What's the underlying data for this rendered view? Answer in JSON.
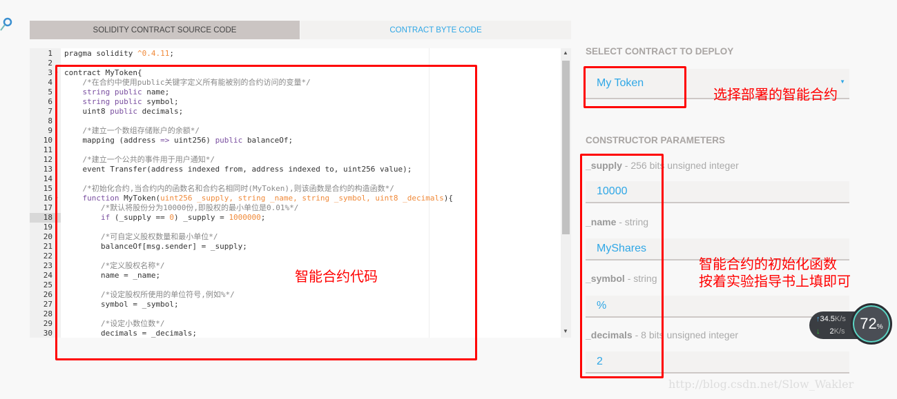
{
  "tabs": [
    {
      "label": "SOLIDITY CONTRACT SOURCE CODE",
      "active": true
    },
    {
      "label": "CONTRACT BYTE CODE",
      "active": false
    }
  ],
  "editor": {
    "active_line": 18,
    "lines": [
      [
        [
          "",
          "pragma solidity "
        ],
        [
          "n",
          "^0.4.11"
        ],
        [
          "",
          ";"
        ]
      ],
      [],
      [
        [
          "",
          "contract MyToken{"
        ]
      ],
      [
        [
          "c",
          "    /*在合约中使用public关键字定义所有能被别的合约访问的变量*/"
        ]
      ],
      [
        [
          "t",
          "    string "
        ],
        [
          "k",
          "public"
        ],
        [
          "",
          " name;"
        ]
      ],
      [
        [
          "t",
          "    string "
        ],
        [
          "k",
          "public"
        ],
        [
          "",
          " symbol;"
        ]
      ],
      [
        [
          "",
          "    uint8 "
        ],
        [
          "k",
          "public"
        ],
        [
          "",
          " decimals;"
        ]
      ],
      [],
      [
        [
          "c",
          "    /*建立一个数组存储账户的余额*/"
        ]
      ],
      [
        [
          "",
          "    mapping (address "
        ],
        [
          "k",
          "=>"
        ],
        [
          "",
          " uint256) "
        ],
        [
          "k",
          "public"
        ],
        [
          "",
          " balanceOf;"
        ]
      ],
      [],
      [
        [
          "c",
          "    /*建立一个公共的事件用于用户通知*/"
        ]
      ],
      [
        [
          "",
          "    event Transfer(address indexed from, address indexed to, uint256 value);"
        ]
      ],
      [],
      [
        [
          "c",
          "    /*初始化合约,当合约内的函数名和合约名相同时(MyToken),则该函数是合约的构造函数*/"
        ]
      ],
      [
        [
          "k",
          "    function"
        ],
        [
          "",
          " MyToken("
        ],
        [
          "n",
          "uint256 _supply, string _name, string _symbol, uint8 _decimals"
        ],
        [
          "",
          "){"
        ]
      ],
      [
        [
          "c",
          "        /*默认将股份分为10000份,即股权的最小单位是0.01%*/"
        ]
      ],
      [
        [
          "k",
          "        if"
        ],
        [
          "",
          " (_supply == "
        ],
        [
          "n",
          "0"
        ],
        [
          "",
          ") _supply = "
        ],
        [
          "n",
          "1000000"
        ],
        [
          "",
          ";"
        ]
      ],
      [],
      [
        [
          "c",
          "        /*可自定义股权数量和最小单位*/"
        ]
      ],
      [
        [
          "",
          "        balanceOf[msg.sender] = _supply;"
        ]
      ],
      [],
      [
        [
          "c",
          "        /*定义股权名称*/"
        ]
      ],
      [
        [
          "",
          "        name = _name;"
        ]
      ],
      [],
      [
        [
          "c",
          "        /*设定股权所使用的单位符号,例如%*/"
        ]
      ],
      [
        [
          "",
          "        symbol = _symbol;"
        ]
      ],
      [],
      [
        [
          "c",
          "        /*设定小数位数*/"
        ]
      ],
      [
        [
          "",
          "        decimals = _decimals;"
        ]
      ]
    ],
    "fold_lines": [
      3,
      16
    ]
  },
  "deploy": {
    "section_title": "SELECT CONTRACT TO DEPLOY",
    "selected_contract": "My Token"
  },
  "constructor": {
    "section_title": "CONSTRUCTOR PARAMETERS",
    "params": [
      {
        "name": "_supply",
        "type": "- 256 bits unsigned integer",
        "value": "10000"
      },
      {
        "name": "_name",
        "type": "- string",
        "value": "MyShares"
      },
      {
        "name": "_symbol",
        "type": "- string",
        "value": "%"
      },
      {
        "name": "_decimals",
        "type": "- 8 bits unsigned integer",
        "value": "2"
      }
    ]
  },
  "annotations": {
    "code": "智能合约代码",
    "select": "选择部署的智能合约",
    "params_line1": "智能合约的初始化函数",
    "params_line2": "按着实验指导书上填即可"
  },
  "network_widget": {
    "upload": "34.5",
    "upload_unit": "K/s",
    "download": "2",
    "download_unit": "K/s",
    "usage_percent": "72",
    "percent_sign": "%"
  },
  "watermark": "http://blog.csdn.net/Slow_Wakler"
}
